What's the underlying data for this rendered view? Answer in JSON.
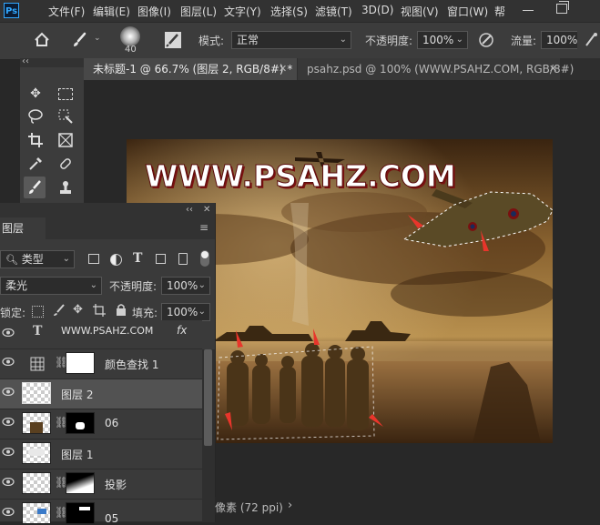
{
  "app": {
    "logo": "Ps"
  },
  "menu": [
    "文件(F)",
    "编辑(E)",
    "图像(I)",
    "图层(L)",
    "文字(Y)",
    "选择(S)",
    "滤镜(T)",
    "3D(D)",
    "视图(V)",
    "窗口(W)",
    "帮"
  ],
  "options": {
    "brush_size": "40",
    "mode_label": "模式:",
    "mode_value": "正常",
    "opacity_label": "不透明度:",
    "opacity_value": "100%",
    "flow_label": "流量:",
    "flow_value": "100%"
  },
  "tabs": [
    {
      "label": "未标题-1 @ 66.7% (图层 2, RGB/8#) *",
      "active": true
    },
    {
      "label": "psahz.psd @ 100% (WWW.PSAHZ.COM, RGB/8#)",
      "active": false
    }
  ],
  "toolbar": {
    "collapse": "‹‹"
  },
  "canvas": {
    "headline": "WWW.PSAHZ.COM",
    "accent_color": "#e8352b"
  },
  "layers_panel": {
    "collapse": "‹‹",
    "tab_label": "图层",
    "filter_label": "类型",
    "blend_mode": "柔光",
    "opacity_label": "不透明度:",
    "opacity_value": "100%",
    "lock_label": "锁定:",
    "fill_label": "填充:",
    "fill_value": "100%",
    "layers": [
      {
        "name": "WWW.PSAHZ.COM",
        "type": "text",
        "fx": "fx"
      },
      {
        "name": "颜色查找 1",
        "type": "adjustment"
      },
      {
        "name": "图层 2",
        "type": "pixel",
        "selected": true
      },
      {
        "name": "06",
        "type": "masked"
      },
      {
        "name": "图层 1",
        "type": "pixel"
      },
      {
        "name": "投影",
        "type": "masked"
      },
      {
        "name": "05",
        "type": "masked"
      }
    ]
  },
  "status": {
    "text": "像素 (72 ppi)",
    "arrow": "›"
  }
}
